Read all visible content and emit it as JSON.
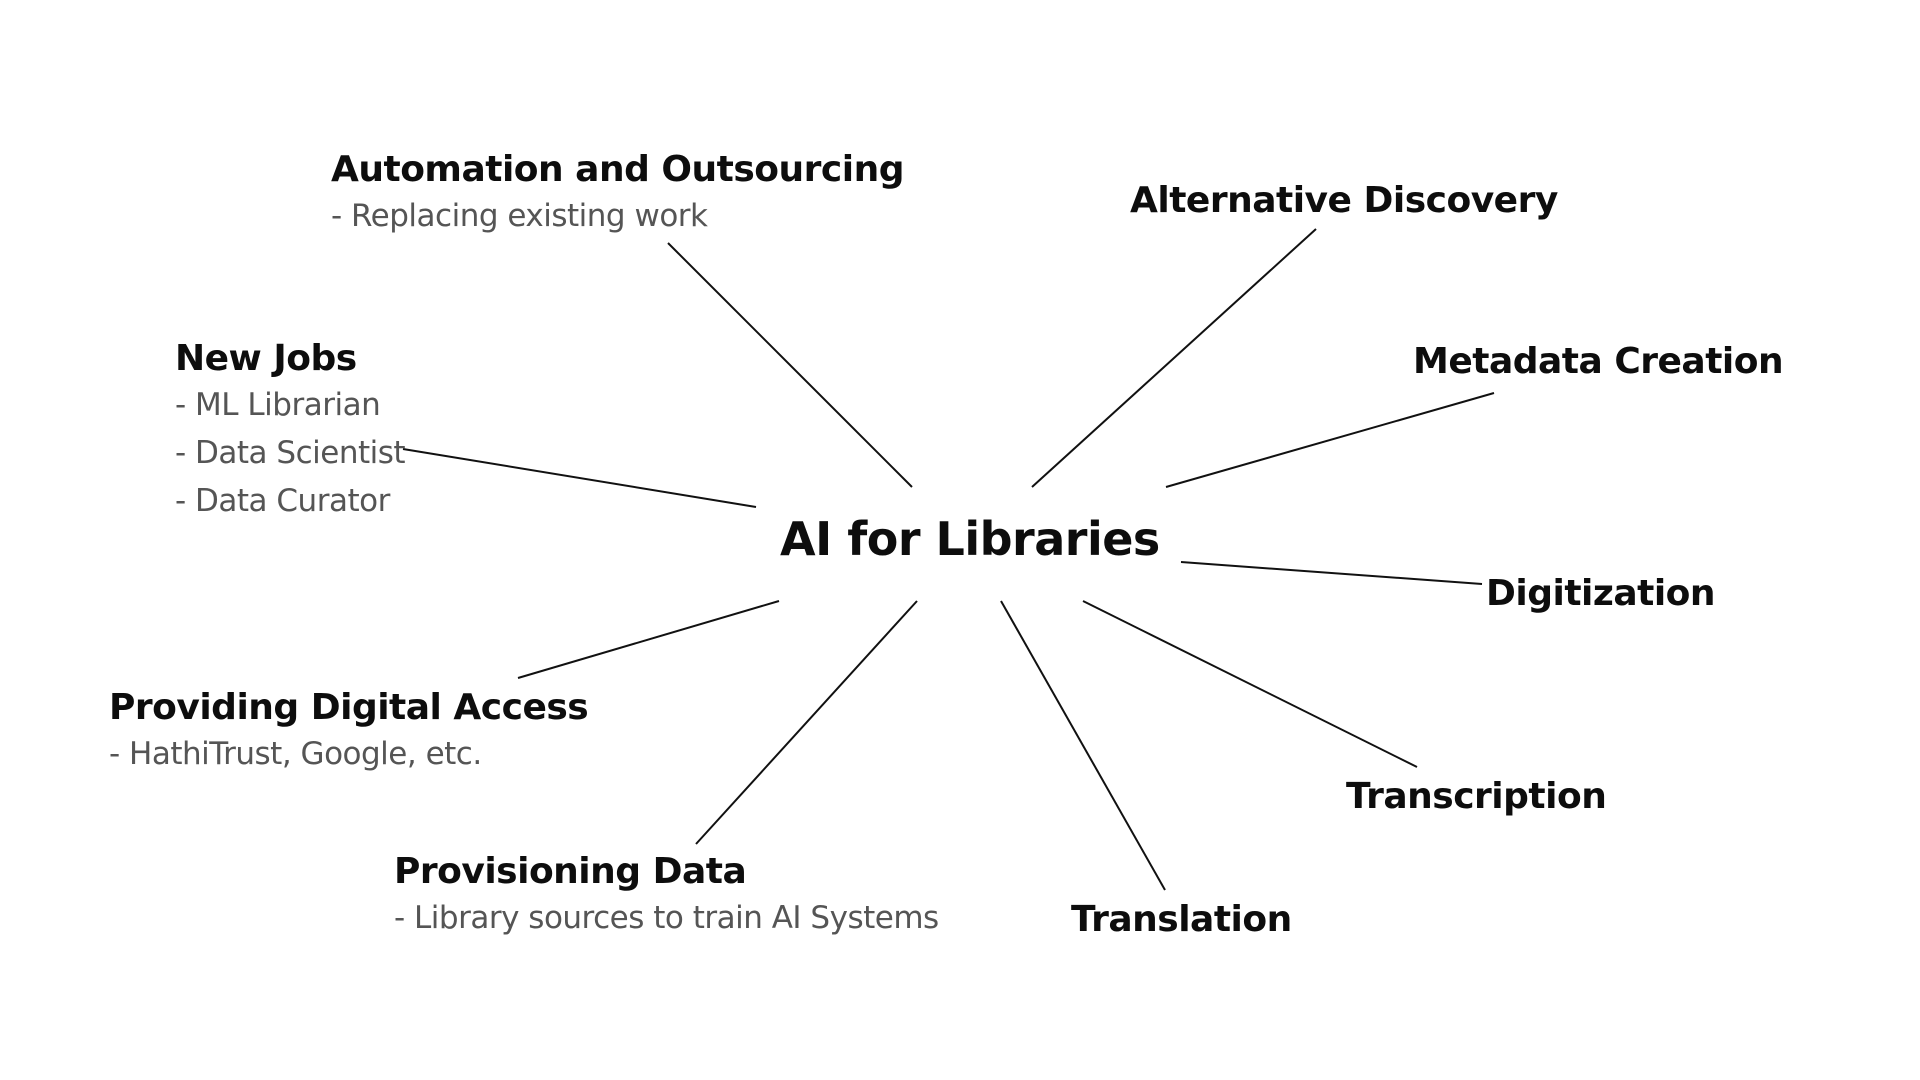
{
  "diagram": {
    "center": {
      "label": "AI for Libraries"
    },
    "nodes": {
      "automation": {
        "title": "Automation and Outsourcing",
        "details": [
          "- Replacing existing work"
        ]
      },
      "alternative_discovery": {
        "title": "Alternative Discovery",
        "details": []
      },
      "new_jobs": {
        "title": "New Jobs",
        "details": [
          "- ML Librarian",
          "- Data Scientist",
          "- Data Curator"
        ]
      },
      "metadata_creation": {
        "title": "Metadata Creation",
        "details": []
      },
      "digitization": {
        "title": "Digitization",
        "details": []
      },
      "providing_digital_access": {
        "title": "Providing Digital Access",
        "details": [
          "- HathiTrust, Google, etc."
        ]
      },
      "transcription": {
        "title": "Transcription",
        "details": []
      },
      "provisioning_data": {
        "title": "Provisioning Data",
        "details": [
          "- Library sources to train AI Systems"
        ]
      },
      "translation": {
        "title": "Translation",
        "details": []
      }
    }
  }
}
